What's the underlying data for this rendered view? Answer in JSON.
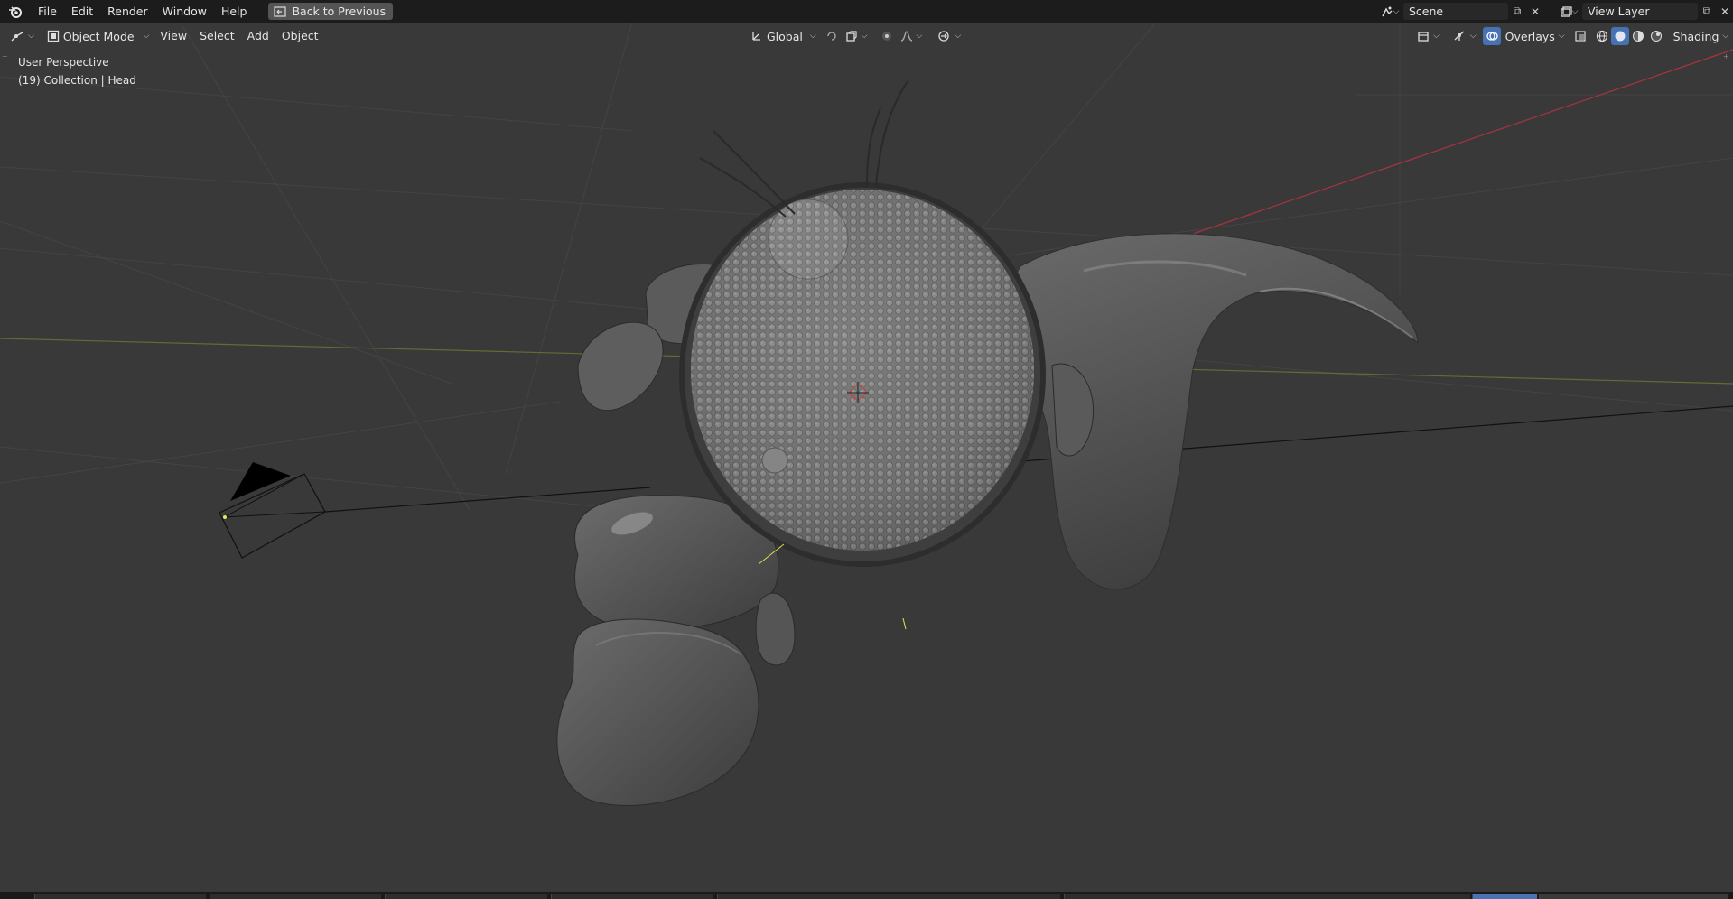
{
  "topbar": {
    "menu": [
      "File",
      "Edit",
      "Render",
      "Window",
      "Help"
    ],
    "back_button": "Back to Previous",
    "scene": {
      "label": "Scene"
    },
    "view_layer": {
      "label": "View Layer"
    }
  },
  "viewport_header": {
    "mode": "Object Mode",
    "menus": [
      "View",
      "Select",
      "Add",
      "Object"
    ],
    "transform_orientation": "Global",
    "overlays": "Overlays",
    "shading": "Shading"
  },
  "viewport": {
    "perspective_label": "User Perspective",
    "collection_label": "(19) Collection | Head"
  },
  "colors": {
    "topbar_bg": "#1c1c1c",
    "viewport_bg": "#393939",
    "x_axis": "#a8343d",
    "y_axis": "#6b8f2a",
    "active_shading": "#4772b3"
  }
}
